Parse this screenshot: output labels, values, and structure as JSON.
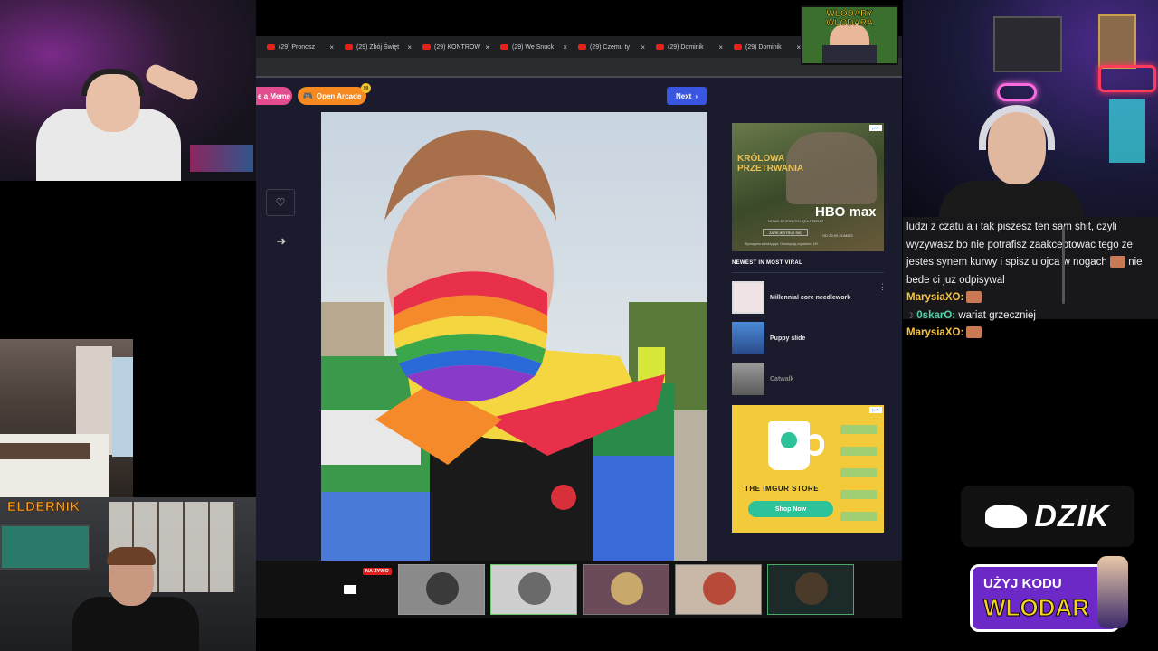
{
  "browser": {
    "tabs": [
      {
        "label": "(29) Pronosz"
      },
      {
        "label": "(29) Zbój Święt"
      },
      {
        "label": "(29) KONTROW"
      },
      {
        "label": "(29) We Snuck"
      },
      {
        "label": "(29) Czemu ty"
      },
      {
        "label": "(29) Dominik"
      },
      {
        "label": "(29) Dominik"
      }
    ],
    "toolbar": {
      "meme_label": "e a Meme",
      "arcade_label": "Open Arcade",
      "arcade_badge": "99",
      "next_label": "Next"
    },
    "ad_hbo": {
      "title": "KRÓLOWA PRZETRWANIA",
      "subtitle": "NOWY SEZON OGLĄDAJ TERAZ",
      "cta": "ZAREJESTRUJ SIĘ",
      "brand": "HBO max",
      "price": "OD 29,99 ZŁ/MIES",
      "legal": "Wymagana subskrypcja. Obowiązują regulamin. 18+"
    },
    "newest": {
      "title": "NEWEST IN MOST VIRAL",
      "items": [
        {
          "label": "Millennial core needlework",
          "thumb_color": "#f0e3e6"
        },
        {
          "label": "Puppy slide",
          "thumb_color": "#3f6fb4"
        },
        {
          "label": "Catwalk",
          "thumb_color": "#8b8b8b"
        }
      ]
    },
    "ad_imgur": {
      "store_label": "THE IMGUR STORE",
      "shop_label": "Shop Now"
    }
  },
  "chat": {
    "messages": [
      {
        "user": "",
        "text": "ludzi z czatu a i tak piszesz ten sam shit, czyli wyzywasz bo nie potrafisz zaakceptowac tego ze jestes synem kurwy i spisz u ojca w nogach",
        "text_after_emote": "nie bede ci juz odpisywal"
      },
      {
        "user": "MarysiaXO:",
        "text": ""
      },
      {
        "user": "0skarO:",
        "text": "wariat grzeczniej"
      },
      {
        "user": "MarysiaXO:",
        "text": ""
      }
    ]
  },
  "participants": {
    "live_badge": "NA ŻYWO",
    "tiles": [
      {
        "color": "#8a8a8a",
        "face": "#3a3a3a"
      },
      {
        "color": "#cfcfcf",
        "face": "#6a6a6a"
      },
      {
        "color": "#6b4a5a",
        "face": "#c9a86b"
      },
      {
        "color": "#c9b8a8",
        "face": "#b84a3a"
      },
      {
        "color": "#1d2a2a",
        "face": "#4a3a2a"
      }
    ]
  },
  "overlay": {
    "dzik": "DZIK",
    "code_line1": "UŻYJ KODU",
    "code_line2": "WLODAR",
    "wlodary": "WLODARY WLODARA",
    "elder": "ELDERNIK"
  },
  "colors": {
    "accent_blue": "#3a56e0",
    "arcade_orange": "#f6891f",
    "chat_user_yellow": "#f6c443",
    "chat_user_green": "#53d1a6"
  }
}
